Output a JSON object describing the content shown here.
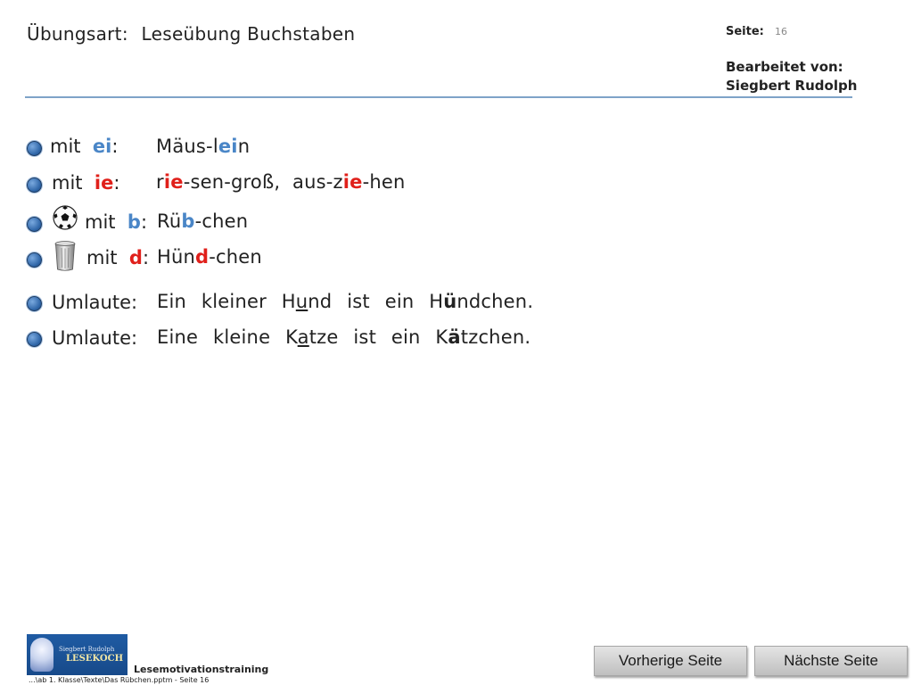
{
  "header": {
    "title_label": "Übungsart:",
    "title_value": "Leseübung Buchstaben",
    "page_label": "Seite:",
    "page_number": "16",
    "edited_label": "Bearbeitet von:",
    "edited_name": "Siegbert Rudolph"
  },
  "rows": [
    {
      "label_pre": "mit",
      "label_key": "ei",
      "label_post": ":",
      "t1": "Mäus-l",
      "t2": "ei",
      "t3": "n"
    },
    {
      "label_pre": "mit",
      "label_key": "ie",
      "label_post": ":",
      "t1": "r",
      "t2": "ie",
      "t3": "-sen-groß,",
      "t4": "aus-z",
      "t5": "ie",
      "t6": "-hen"
    },
    {
      "label_pre": "mit",
      "label_key": "b",
      "label_post": ":",
      "t1": "Rü",
      "t2": "b",
      "t3": "-chen",
      "icon": "soccer-ball-icon"
    },
    {
      "label_pre": "mit",
      "label_key": "d",
      "label_post": ":",
      "t1": "Hün",
      "t2": "d",
      "t3": "-chen",
      "icon": "trash-can-icon"
    },
    {
      "label": "Umlaute:",
      "s1": "Ein kleiner H",
      "s2": "u",
      "s3": "nd ist ein H",
      "s4": "ü",
      "s5": "ndchen."
    },
    {
      "label": "Umlaute:",
      "s1": "Eine kleine K",
      "s2": "a",
      "s3": "tze ist ein K",
      "s4": "ä",
      "s5": "tzchen."
    }
  ],
  "footer": {
    "logo_line1": "Siegbert Rudolph",
    "logo_line2": "LESEKOCH",
    "program_label": "Lesemotivationstraining",
    "path": "...\\ab 1. Klasse\\Texte\\Das Rübchen.pptm - Seite 16",
    "prev_button": "Vorherige Seite",
    "next_button": "Nächste Seite"
  },
  "colors": {
    "accent_blue": "#4a86c7",
    "accent_red": "#e0201b",
    "rule": "#7ea3c8"
  }
}
